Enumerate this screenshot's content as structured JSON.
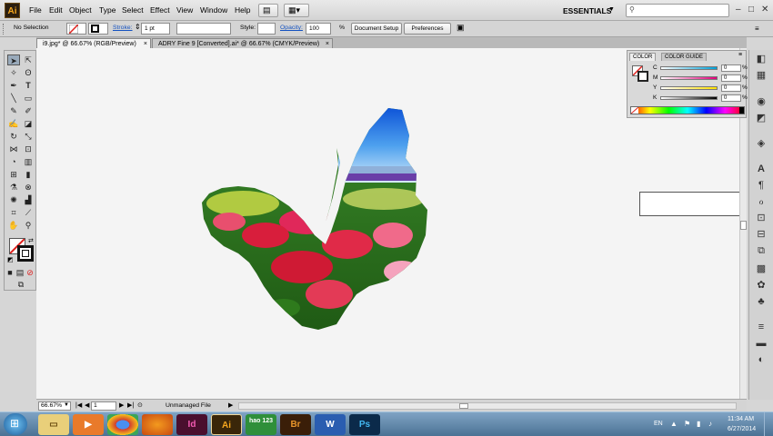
{
  "app": {
    "logo": "Ai"
  },
  "menu": [
    "File",
    "Edit",
    "Object",
    "Type",
    "Select",
    "Effect",
    "View",
    "Window",
    "Help"
  ],
  "workspace": {
    "label": "ESSENTIALS"
  },
  "control": {
    "selection": "No Selection",
    "stroke_label": "Stroke:",
    "stroke_value": "1 pt",
    "style_label": "Style:",
    "opacity_label": "Opacity:",
    "opacity_value": "100",
    "opacity_unit": "%",
    "document_setup": "Document Setup",
    "preferences": "Preferences"
  },
  "tabs": [
    "i9.jpg* @ 66.67% (RGB/Preview)",
    "ADRY Fine 9 [Converted].ai* @ 66.67% (CMYK/Preview)"
  ],
  "color_panel": {
    "tabs": [
      "COLOR",
      "COLOR GUIDE"
    ],
    "sliders": [
      {
        "label": "C",
        "value": "0",
        "unit": "%",
        "color": "#00a0d8"
      },
      {
        "label": "M",
        "value": "0",
        "unit": "%",
        "color": "#e0007a"
      },
      {
        "label": "Y",
        "value": "0",
        "unit": "%",
        "color": "#ffe000"
      },
      {
        "label": "K",
        "value": "0",
        "unit": "%",
        "color": "#000000"
      }
    ]
  },
  "status": {
    "zoom": "66.67%",
    "page": "1",
    "info": "Unmanaged File"
  },
  "taskbar": {
    "lang": "EN",
    "time": "11:34 AM",
    "date": "6/27/2014",
    "apps": [
      "Id",
      "Ai",
      "hao 123",
      "Br",
      "W",
      "Ps"
    ]
  },
  "colors": {
    "accent": "#f6a71e",
    "link": "#1452c0"
  }
}
